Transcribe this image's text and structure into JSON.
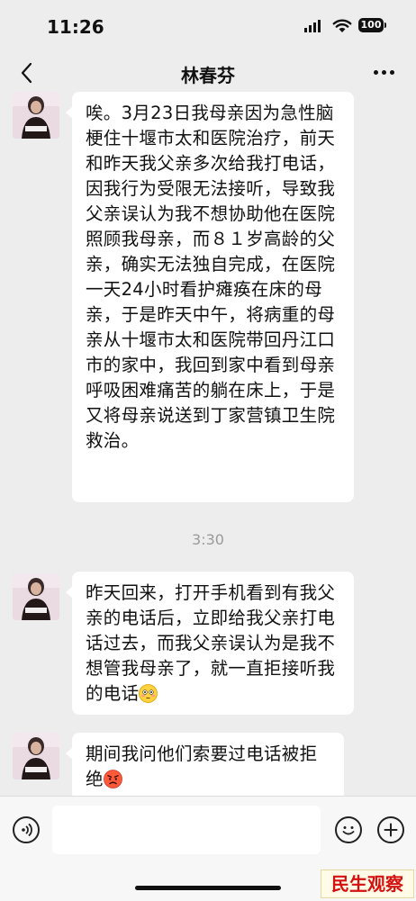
{
  "status_bar": {
    "time": "11:26",
    "battery": "100"
  },
  "header": {
    "title": "林春芬"
  },
  "messages": [
    {
      "text": "唉。3月23日我母亲因为急性脑梗住十堰市太和医院治疗，前天和昨天我父亲多次给我打电话，因我行为受限无法接听，导致我父亲误认为我不想协助他在医院照顾我母亲，而８１岁高龄的父亲，确实无法独自完成，在医院一天24小时看护瘫痪在床的母亲，于是昨天中午，将病重的母亲从十堰市太和医院带回丹江口市的家中，我回到家中看到母亲呼吸困难痛苦的躺在床上，于是又将母亲说送到丁家营镇卫生院救治。"
    },
    {
      "text": "昨天回来，打开手机看到有我父亲的电话后，立即给我父亲打电话过去，而我父亲误认为是我不想管我母亲了，就一直拒接听我的电话",
      "emoji": "flushed-face-emoji"
    },
    {
      "text": "期间我问他们索要过电话被拒绝",
      "emoji": "angry-face-emoji"
    }
  ],
  "timestamp": "3:30",
  "watermark": "民生观察",
  "icons": {
    "back": "chevron-left-icon",
    "more": "more-dots-icon",
    "voice": "voice-icon",
    "emoji": "emoji-icon",
    "add": "plus-icon"
  }
}
